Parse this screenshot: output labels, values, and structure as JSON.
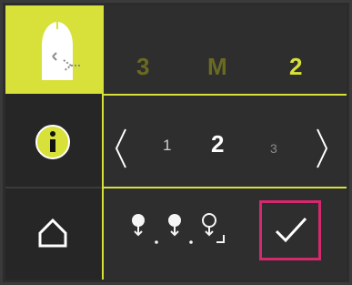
{
  "header": {
    "left": "3",
    "mid": "M",
    "right": "2"
  },
  "pager": {
    "prev": "1",
    "current": "2",
    "next": "3"
  },
  "icons": {
    "mode": "user-mode-icon",
    "info": "info-icon",
    "home": "home-icon",
    "sequence": "sequence-steps-icon",
    "confirm": "check-icon",
    "prev": "chevron-left-icon",
    "next": "chevron-right-icon"
  },
  "colors": {
    "accent": "#d7e13a",
    "highlight": "#d6286f",
    "background": "#2e2e2e"
  }
}
